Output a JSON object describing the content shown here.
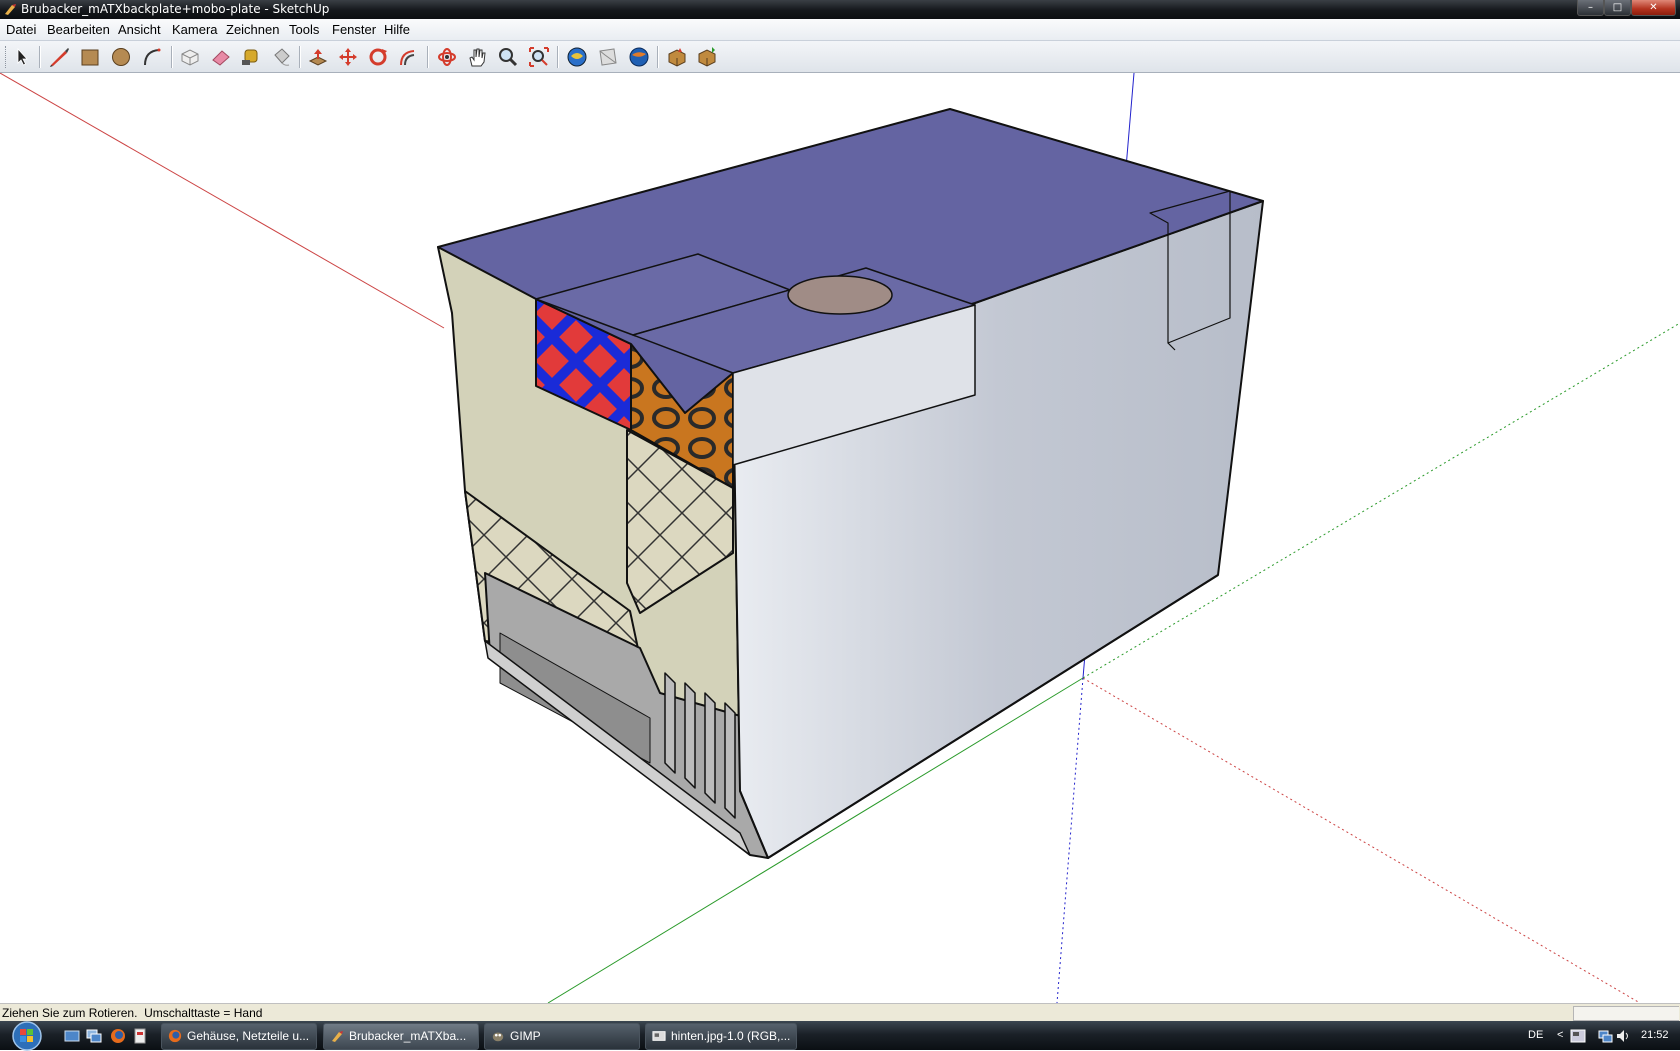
{
  "window": {
    "title": "Brubacker_mATXbackplate+mobo-plate - SketchUp",
    "controls": {
      "minimize": "–",
      "maximize": "□",
      "close": "✕"
    }
  },
  "menubar": {
    "items": [
      "Datei",
      "Bearbeiten",
      "Ansicht",
      "Kamera",
      "Zeichnen",
      "Tools",
      "Fenster",
      "Hilfe"
    ]
  },
  "toolbar": {
    "tools": [
      {
        "name": "select-tool-icon"
      },
      {
        "name": "line-tool-icon"
      },
      {
        "name": "rectangle-tool-icon"
      },
      {
        "name": "circle-tool-icon"
      },
      {
        "name": "arc-tool-icon"
      },
      {
        "name": "make-component-icon"
      },
      {
        "name": "eraser-tool-icon"
      },
      {
        "name": "tape-measure-icon"
      },
      {
        "name": "paint-bucket-icon"
      },
      {
        "name": "push-pull-icon"
      },
      {
        "name": "move-tool-icon"
      },
      {
        "name": "rotate-tool-icon"
      },
      {
        "name": "offset-tool-icon"
      },
      {
        "name": "orbit-tool-icon"
      },
      {
        "name": "pan-tool-icon"
      },
      {
        "name": "zoom-tool-icon"
      },
      {
        "name": "zoom-extents-icon"
      },
      {
        "name": "previous-view-icon"
      },
      {
        "name": "next-view-icon"
      },
      {
        "name": "google-earth-icon"
      },
      {
        "name": "get-models-icon"
      },
      {
        "name": "share-model-icon"
      }
    ]
  },
  "statusbar": {
    "text": "Ziehen Sie zum Rotieren.  Umschalttaste = Hand"
  },
  "taskbar": {
    "quicklaunch": [
      "show-desktop-icon",
      "switch-windows-icon",
      "firefox-icon",
      "document-icon"
    ],
    "tasks": [
      {
        "label": "Gehäuse, Netzteile u...",
        "icon": "firefox-icon"
      },
      {
        "label": "Brubacker_mATXba...",
        "icon": "sketchup-icon"
      },
      {
        "label": "GIMP",
        "icon": "gimp-icon"
      },
      {
        "label": "hinten.jpg-1.0 (RGB,...",
        "icon": "image-window-icon"
      }
    ],
    "tray": {
      "language": "DE",
      "expand": "<",
      "clock": "21:52"
    }
  },
  "colors": {
    "top_face": "#6464a2",
    "side_face": "#c6cbd6",
    "left_face": "#d3d2b9",
    "axis_red": "#c44",
    "axis_green": "#2a9a2a",
    "axis_blue": "#2222cc"
  }
}
